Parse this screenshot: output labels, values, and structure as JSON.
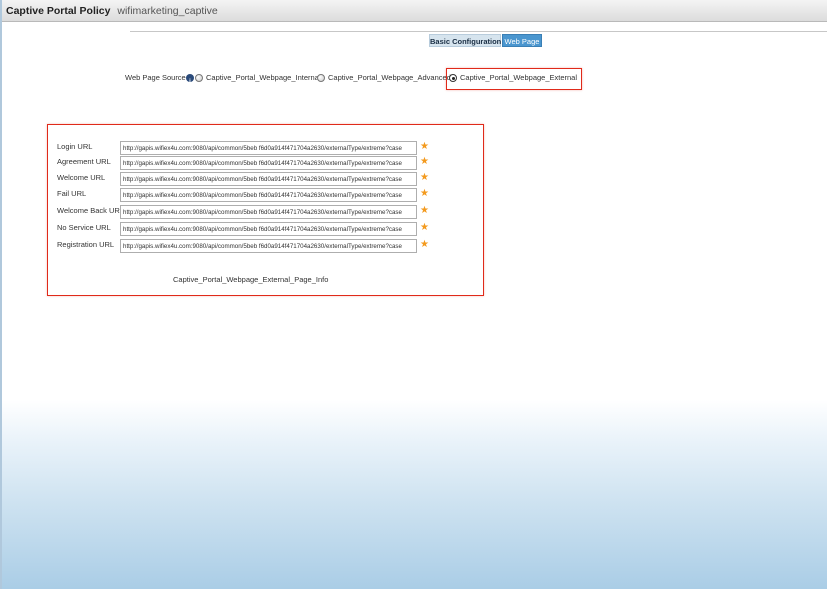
{
  "title_bar": {
    "title": "Captive Portal Policy",
    "policy_name": "wifimarketing_captive"
  },
  "tabs": [
    {
      "label": "Basic Configuration",
      "active": false
    },
    {
      "label": "Web Page",
      "active": true
    }
  ],
  "web_page_source": {
    "label": "Web Page Source",
    "options": [
      {
        "label": "Captive_Portal_Webpage_Internal",
        "selected": false
      },
      {
        "label": "Captive_Portal_Webpage_Advanced",
        "selected": false
      },
      {
        "label": "Captive_Portal_Webpage_External",
        "selected": true
      }
    ]
  },
  "urls": [
    {
      "label": "Login URL",
      "value": "http://gapis.wifiex4u.com:9080/api/common/5beb f6d0a914f471704a2630/externalType/extreme?case"
    },
    {
      "label": "Agreement URL",
      "value": "http://gapis.wifiex4u.com:9080/api/common/5beb f6d0a914f471704a2630/externalType/extreme?case"
    },
    {
      "label": "Welcome URL",
      "value": "http://gapis.wifiex4u.com:9080/api/common/5beb f6d0a914f471704a2630/externalType/extreme?case"
    },
    {
      "label": "Fail URL",
      "value": "http://gapis.wifiex4u.com:9080/api/common/5beb f6d0a914f471704a2630/externalType/extreme?case"
    },
    {
      "label": "Welcome Back URL",
      "value": "http://gapis.wifiex4u.com:9080/api/common/5beb f6d0a914f471704a2630/externalType/extreme?case"
    },
    {
      "label": "No Service URL",
      "value": "http://gapis.wifiex4u.com:9080/api/common/5beb f6d0a914f471704a2630/externalType/extreme?case"
    },
    {
      "label": "Registration URL",
      "value": "http://gapis.wifiex4u.com:9080/api/common/5beb f6d0a914f471704a2630/externalType/extreme?case"
    }
  ],
  "required_marker": "★",
  "page_info": "Captive_Portal_Webpage_External_Page_Info",
  "colors": {
    "highlight_border": "#e02a1a",
    "active_tab": "#4a96cf",
    "required_star": "#f39a1e"
  }
}
